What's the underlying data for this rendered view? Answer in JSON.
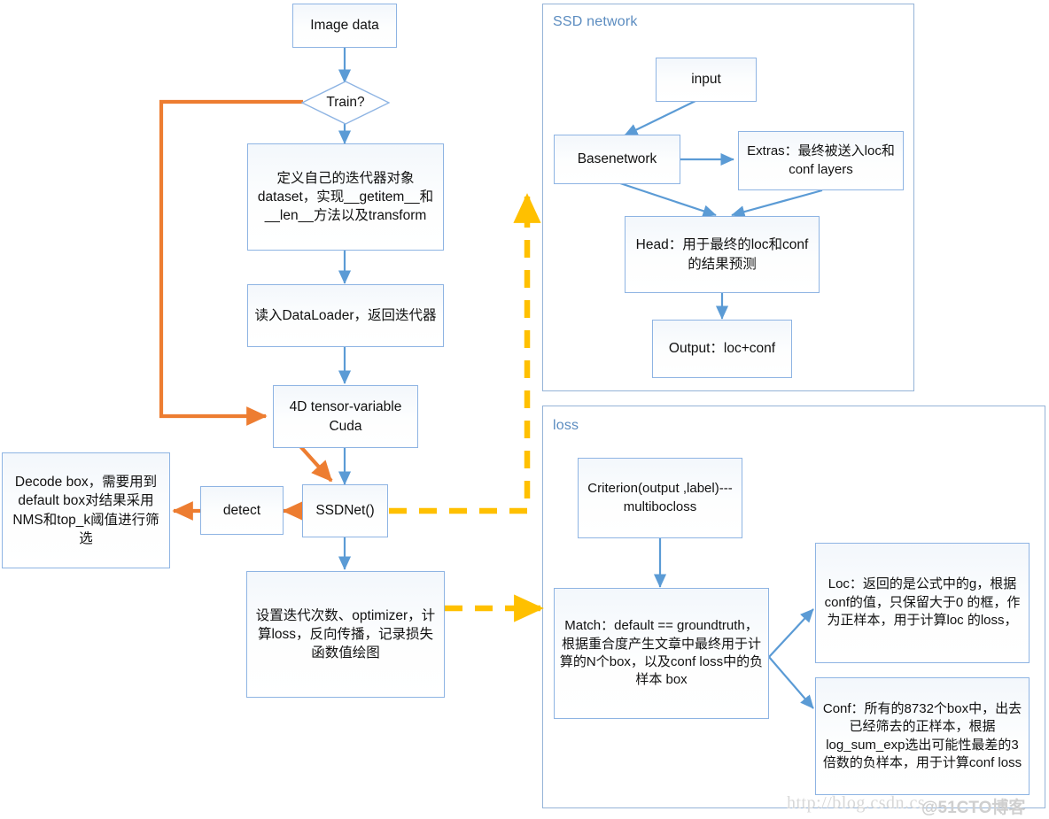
{
  "panels": {
    "ssd_network": {
      "title": "SSD network"
    },
    "loss": {
      "title": "loss"
    }
  },
  "nodes": {
    "image_data": "Image data",
    "train_decision": "Train?",
    "dataset_def": "定义自己的迭代器对象dataset，实现__getitem__和__len__方法以及transform",
    "dataloader": "读入DataLoader，返回迭代器",
    "tensor_cuda": "4D tensor-variable Cuda",
    "ssdnet": "SSDNet()",
    "detect": "detect",
    "decode_box": "Decode box，需要用到default box对结果采用NMS和top_k阈值进行筛选",
    "train_loop": "设置迭代次数、optimizer，计算loss，反向传播，记录损失函数值绘图",
    "input": "input",
    "basenetwork": "Basenetwork",
    "extras": "Extras：最终被送入loc和conf layers",
    "head": "Head：用于最终的loc和conf的结果预测",
    "output": "Output：loc+conf",
    "criterion": "Criterion(output ,label)---multibocloss",
    "match": "Match：default == groundtruth，根据重合度产生文章中最终用于计算的N个box，以及conf loss中的负样本 box",
    "loc": "Loc：返回的是公式中的g，根据conf的值，只保留大于0 的框，作为正样本，用于计算loc 的loss，",
    "conf": "Conf：所有的8732个box中，出去已经筛去的正样本，根据log_sum_exp选出可能性最差的3倍数的负样本，用于计算conf loss"
  },
  "watermark": {
    "url": "http://blog.csdn.cs",
    "tag": "@51CTO博客"
  },
  "colors": {
    "node_border": "#8eb4e3",
    "panel_border": "#95b3d7",
    "blue_arrow": "#5b9bd5",
    "orange_arrow": "#ed7d31",
    "yellow_arrow": "#ffc000",
    "panel_title": "#5b8cc0",
    "text": "#111111"
  }
}
